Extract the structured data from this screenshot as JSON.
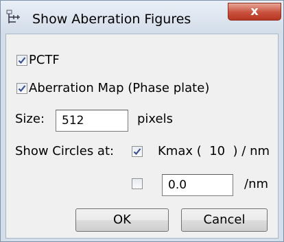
{
  "window": {
    "title": "Show Aberration Figures",
    "close_glyph": "x",
    "app_icon": "dialog-app-icon"
  },
  "options": {
    "pctf": {
      "label": "PCTF",
      "checked": true
    },
    "aberration_map": {
      "label": "Aberration Map (Phase plate)",
      "checked": true
    }
  },
  "size": {
    "label": "Size:",
    "value": "512",
    "unit": "pixels"
  },
  "circles": {
    "label": "Show Circles at:",
    "kmax": {
      "checked": true,
      "text": "Kmax (  10  ) / nm"
    },
    "custom": {
      "checked": false,
      "value": "0.0",
      "unit": "/nm"
    }
  },
  "buttons": {
    "ok": "OK",
    "cancel": "Cancel"
  }
}
